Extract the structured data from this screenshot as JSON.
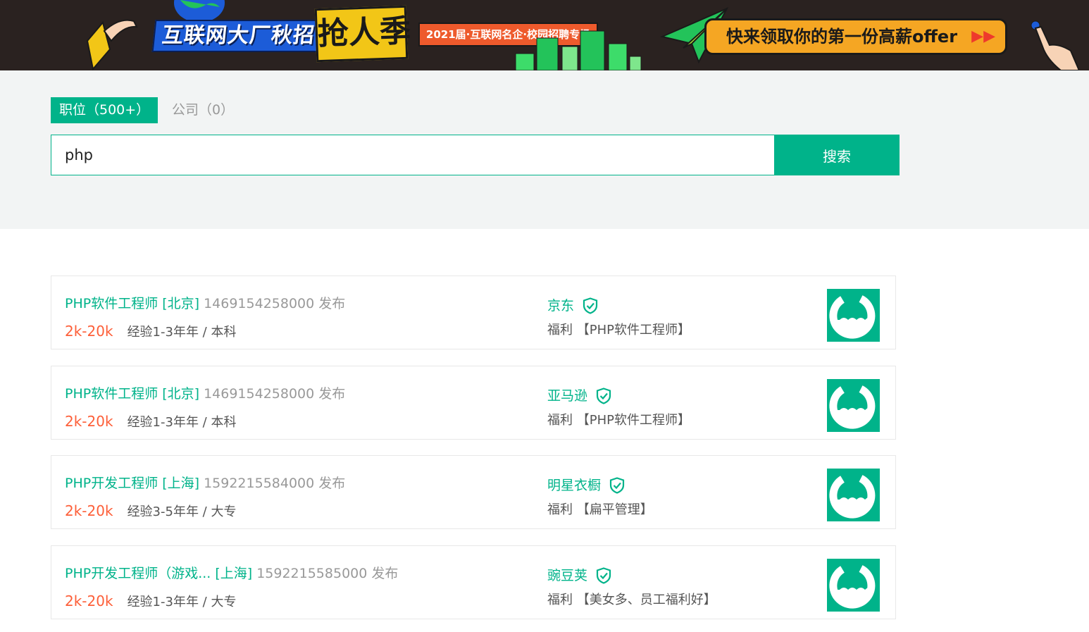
{
  "banner": {
    "title": "互联网大厂秋招",
    "season": "抢人季",
    "tag": "2021届·互联网名企·校园招聘专场",
    "offer": "快来领取你的第一份高薪offer",
    "offer_icon": "double-arrow-right-icon"
  },
  "tabs": {
    "positions": "职位（500+）",
    "companies": "公司（0）"
  },
  "search": {
    "value": "php",
    "button": "搜索"
  },
  "jobs": [
    {
      "title": "PHP软件工程师 [北京]",
      "time": "1469154258000 发布",
      "salary": "2k-20k",
      "requirements": "经验1-3年年 / 本科",
      "company": "京东",
      "benefits": "福利 【PHP软件工程师】"
    },
    {
      "title": "PHP软件工程师 [北京]",
      "time": "1469154258000 发布",
      "salary": "2k-20k",
      "requirements": "经验1-3年年 / 本科",
      "company": "亚马逊",
      "benefits": "福利 【PHP软件工程师】"
    },
    {
      "title": "PHP开发工程师 [上海]",
      "time": "1592215584000 发布",
      "salary": "2k-20k",
      "requirements": "经验3-5年年 / 大专",
      "company": "明星衣橱",
      "benefits": "福利 【扁平管理】"
    },
    {
      "title": "PHP开发工程师（游戏... [上海]",
      "time": "1592215585000 发布",
      "salary": "2k-20k",
      "requirements": "经验1-3年年 / 大专",
      "company": "豌豆荚",
      "benefits": "福利 【美女多、员工福利好】"
    }
  ],
  "colors": {
    "accent": "#00b38a",
    "salary": "#fd5f39",
    "banner_bg": "#2a2220"
  }
}
